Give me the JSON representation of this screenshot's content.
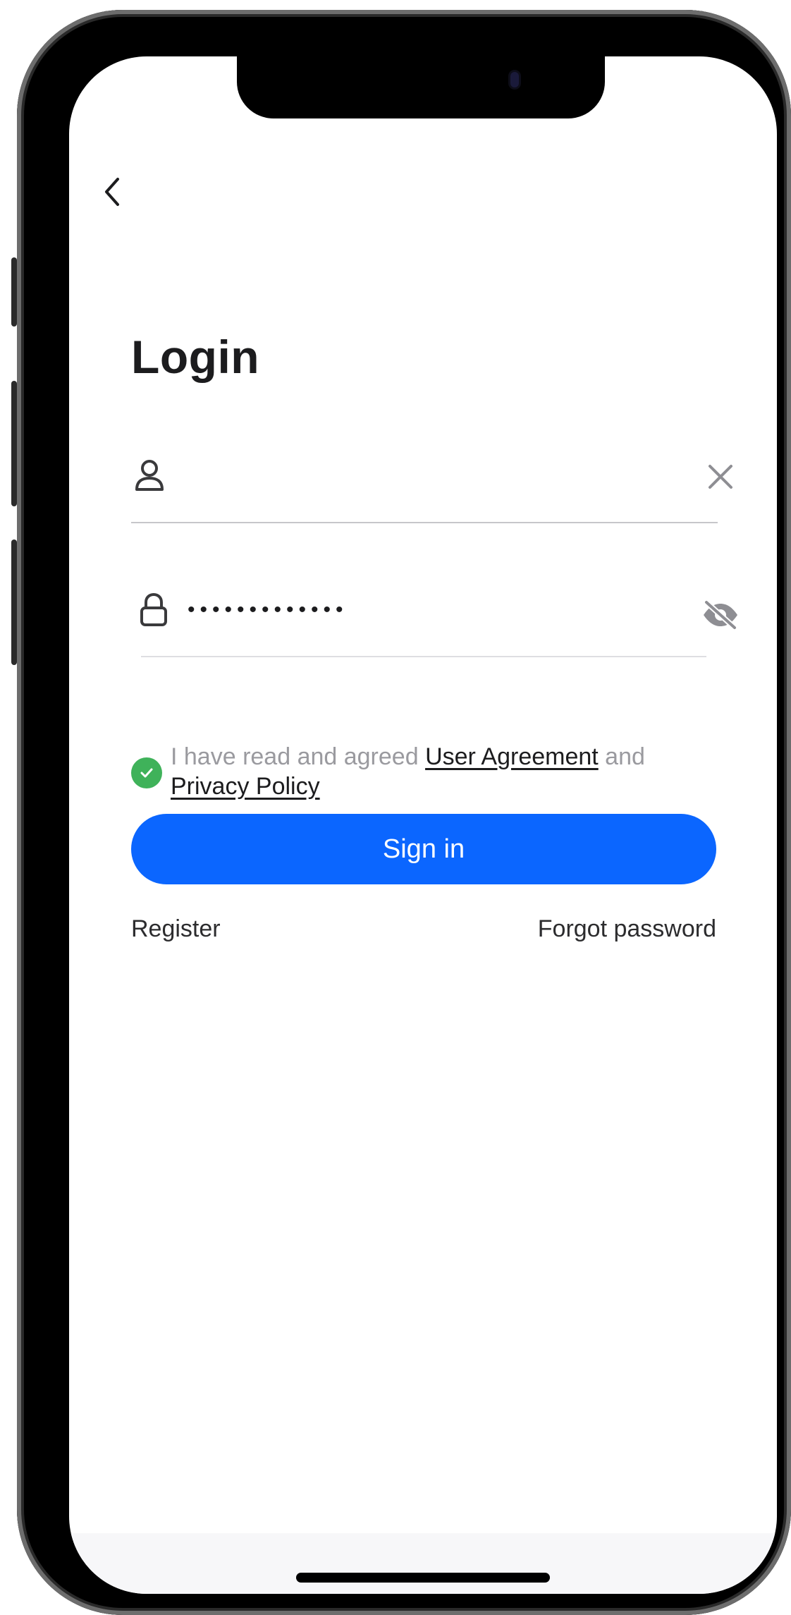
{
  "header": {
    "back_icon": "chevron-left-icon"
  },
  "page": {
    "title": "Login"
  },
  "form": {
    "username": {
      "icon": "user-icon",
      "value": "",
      "clear_icon": "close-icon"
    },
    "password": {
      "icon": "lock-icon",
      "value": "•••••••••••••",
      "toggle_icon": "eye-off-icon"
    }
  },
  "agreement": {
    "checked": true,
    "prefix": "I have read and agreed ",
    "user_agreement": "User Agreement",
    "middle": " and ",
    "privacy_policy": "Privacy Policy"
  },
  "actions": {
    "sign_in": "Sign in",
    "register": "Register",
    "forgot_password": "Forgot password"
  },
  "colors": {
    "primary": "#0B66FF",
    "success": "#3FB25A",
    "text": "#1C1C1E",
    "muted": "#9A9A9F"
  }
}
